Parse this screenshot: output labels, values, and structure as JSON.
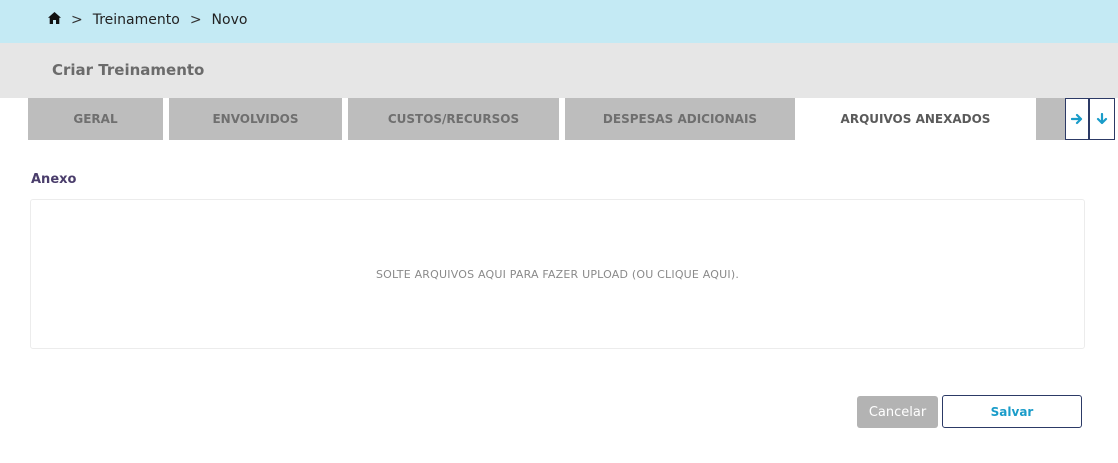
{
  "breadcrumb": {
    "home_icon": "home-icon",
    "separator": ">",
    "items": [
      "Treinamento",
      "Novo"
    ]
  },
  "page": {
    "title": "Criar Treinamento"
  },
  "tabs": [
    {
      "label": "GERAL",
      "active": false
    },
    {
      "label": "ENVOLVIDOS",
      "active": false
    },
    {
      "label": "CUSTOS/RECURSOS",
      "active": false
    },
    {
      "label": "DESPESAS ADICIONAIS",
      "active": false
    },
    {
      "label": "ARQUIVOS ANEXADOS",
      "active": true
    },
    {
      "label": "",
      "active": false
    }
  ],
  "tab_nav": {
    "next_icon": "arrow-right-icon",
    "expand_icon": "arrow-down-icon"
  },
  "attachment": {
    "label": "Anexo",
    "dropzone_text": "SOLTE ARQUIVOS AQUI PARA FAZER UPLOAD (OU CLIQUE AQUI)."
  },
  "actions": {
    "cancel_label": "Cancelar",
    "save_label": "Salvar"
  },
  "colors": {
    "topbar": "#c4eaf4",
    "accent": "#1a9cc9",
    "tab_inactive": "#bdbdbd",
    "border_dark": "#2c3a66"
  }
}
